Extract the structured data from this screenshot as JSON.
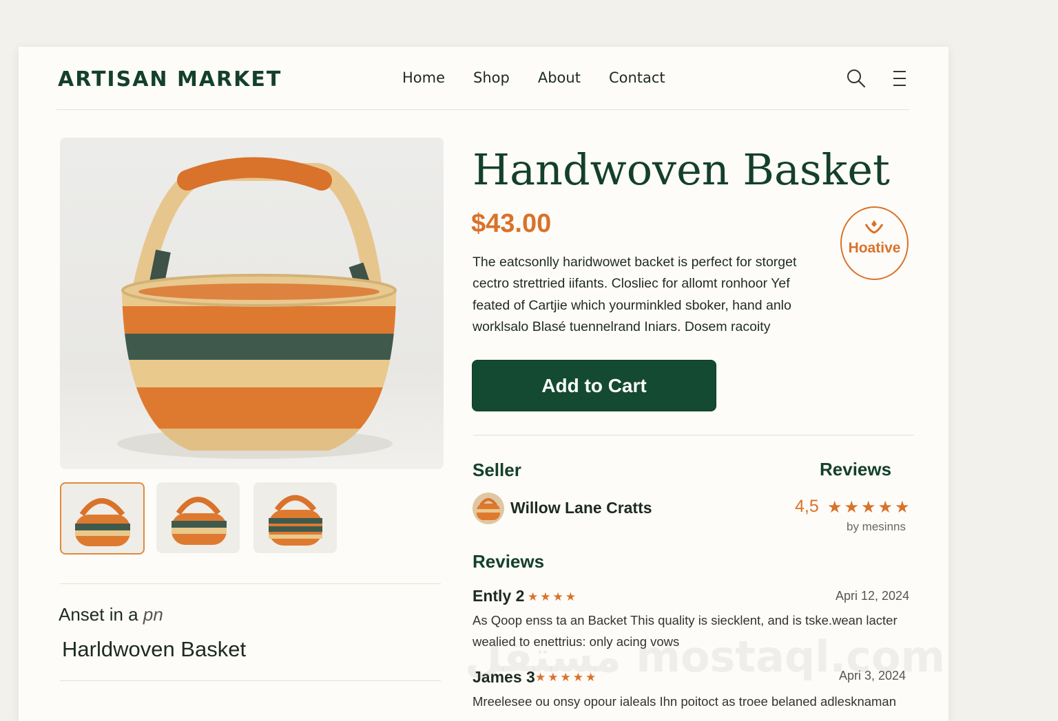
{
  "header": {
    "logo": "ARTISAN MARKET",
    "nav": [
      "Home",
      "Shop",
      "About",
      "Contact"
    ],
    "icons": [
      "search-icon",
      "hamburger-menu-icon"
    ]
  },
  "product": {
    "title": "Handwoven Basket",
    "price": "$43.00",
    "description": [
      "The eatcsonlly haridwowet backet is perfect for storget",
      "cectro strettried iifants. Closliec for allomt ronhoor Yef",
      "feated of Cartjie which yourminkled sboker, hand anlo",
      "worklsalo Blasé tuennelrand Iniars. Dosem racoity"
    ],
    "badge": "Hoative",
    "add_to_cart": "Add to Cart"
  },
  "artisan": {
    "heading": "Anset in a ",
    "heading_italic": "pn",
    "name": "Harldwoven Basket"
  },
  "seller": {
    "heading": "Seller",
    "name": "Willow Lane Cratts"
  },
  "rating": {
    "heading": "Reviews",
    "score": "4,5",
    "stars": 5,
    "by": "by mesinns"
  },
  "reviews": {
    "heading": "Reviews",
    "items": [
      {
        "name": "Ently 2",
        "stars": 4,
        "date": "Apri 12, 2024",
        "text": "As Qoop enss ta an Backet This quality is siecklent, and is tske.wean lacter wealied to enettrius: only acing vows"
      },
      {
        "name": "James 3",
        "stars": 5,
        "date": "Apri 3, 2024",
        "text": "Mreelesee ou onsy opour ialeals Ihn poitoct as troee belaned adlesknaman"
      }
    ]
  },
  "watermark": "مستقل mostaql.com",
  "colors": {
    "brand_green": "#154a32",
    "accent_orange": "#d9722a",
    "background": "#fdfcf8"
  }
}
